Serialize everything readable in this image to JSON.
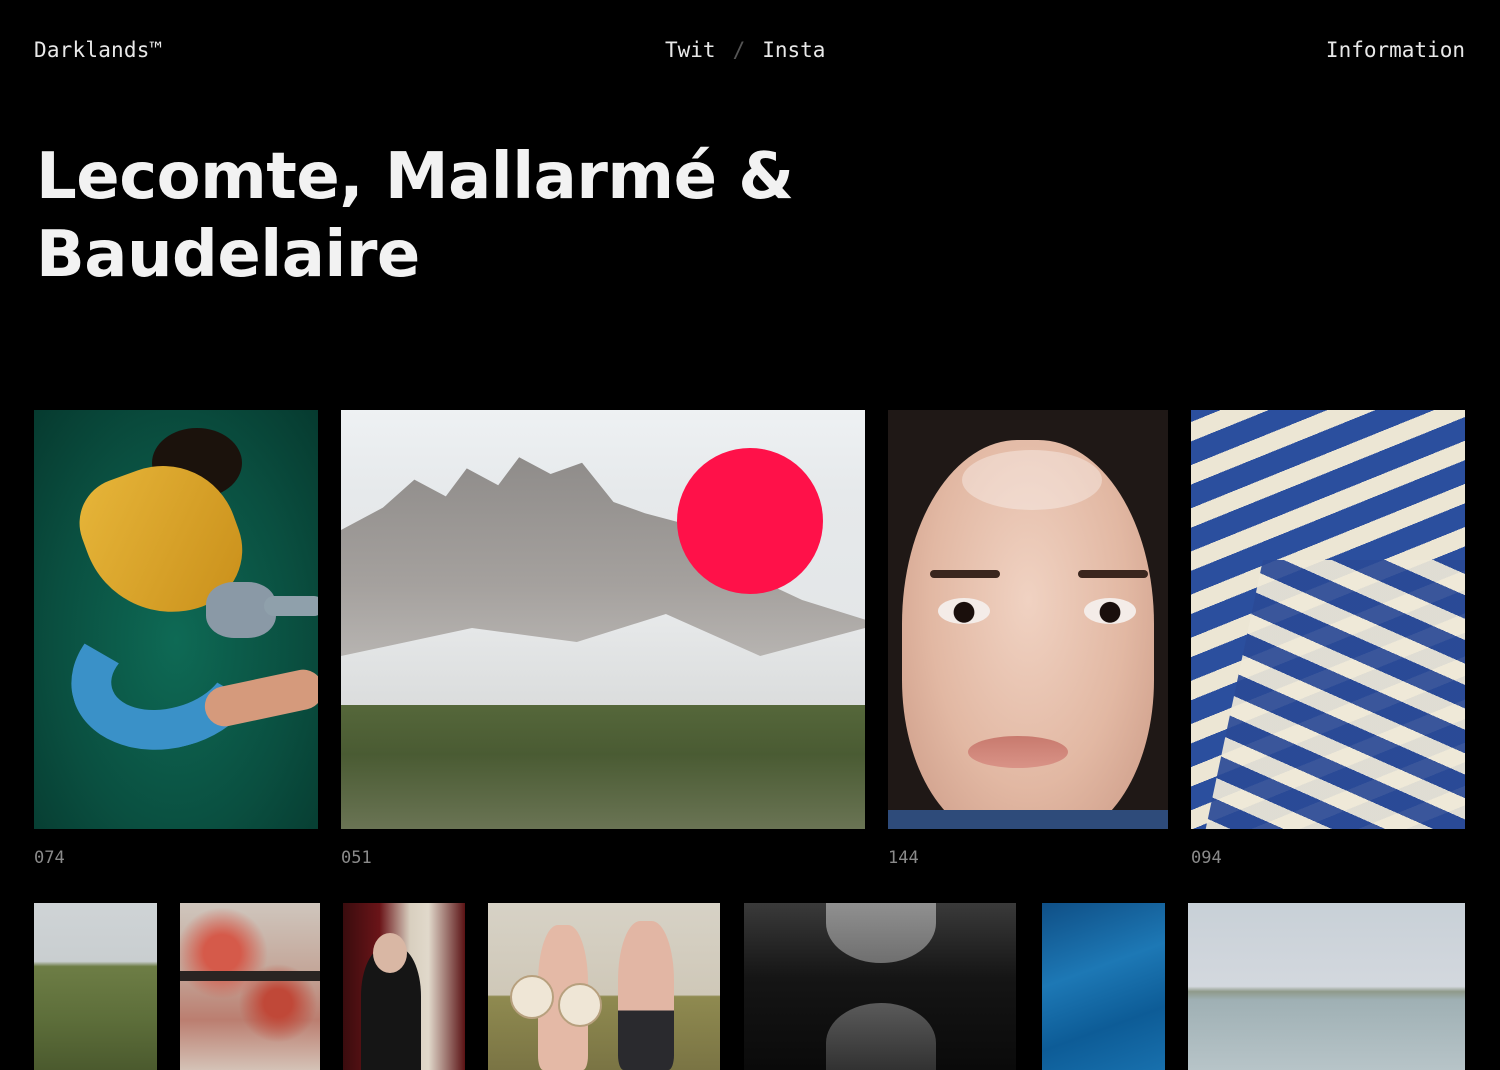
{
  "header": {
    "brand": "Darklands™",
    "social": {
      "twit": "Twit",
      "separator": "/",
      "insta": "Insta"
    },
    "information": "Information"
  },
  "title": "Lecomte, Mallarmé & Baudelaire",
  "accent_color": "#ff1149",
  "tiles": [
    {
      "number": "074"
    },
    {
      "number": "051"
    },
    {
      "number": "144"
    },
    {
      "number": "094"
    }
  ]
}
